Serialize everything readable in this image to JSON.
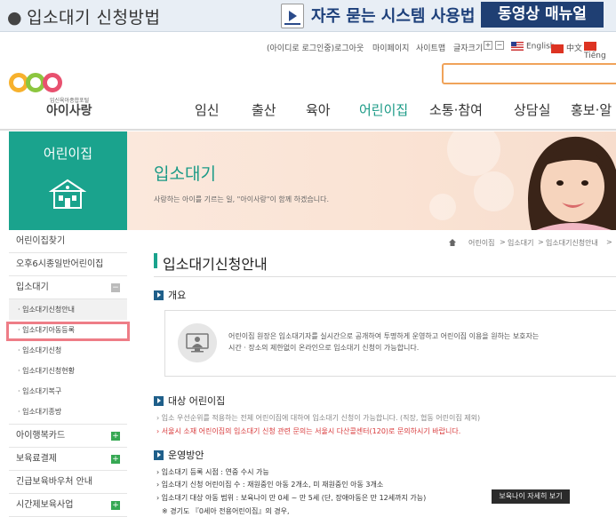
{
  "banner": {
    "title": "입소대기 신청방법",
    "faq": "자주 묻는 시스템 사용법",
    "manual": "동영상 매뉴얼"
  },
  "util": {
    "login": "(아이디로 로그인중)로그아웃",
    "mypage": "마이페이지",
    "sitemap": "사이트맵",
    "fontsize": "글자크기",
    "plus": "+",
    "minus": "−",
    "english": "English",
    "chinese": "中文",
    "vietnamese": "Tiếng"
  },
  "logo": {
    "sub": "임신육아종합포털",
    "main": "아이사랑"
  },
  "gnb": [
    "임신",
    "출산",
    "육아",
    "어린이집",
    "소통·참여",
    "상담실",
    "홍보·알"
  ],
  "sidebar": {
    "title": "어린이집",
    "items": [
      {
        "label": "어린이집찾기",
        "type": "main"
      },
      {
        "label": "오후6시종일반어린이집",
        "type": "main"
      },
      {
        "label": "입소대기",
        "type": "main",
        "toggle": "−"
      },
      {
        "label": "· 입소대기신청안내",
        "type": "sub",
        "active": true
      },
      {
        "label": "· 입소대기아동등록",
        "type": "sub"
      },
      {
        "label": "· 입소대기신청",
        "type": "sub"
      },
      {
        "label": "· 입소대기신청현황",
        "type": "sub"
      },
      {
        "label": "· 입소대기복구",
        "type": "sub"
      },
      {
        "label": "· 입소대기종방",
        "type": "sub"
      },
      {
        "label": "아이행복카드",
        "type": "main",
        "toggle": "+"
      },
      {
        "label": "보육료결제",
        "type": "main",
        "toggle": "+"
      },
      {
        "label": "긴급보육바우처 안내",
        "type": "main"
      },
      {
        "label": "시간제보육사업",
        "type": "main",
        "toggle": "+"
      }
    ]
  },
  "hero": {
    "title": "입소대기",
    "subtitle": "사랑하는 아이를 기르는 일, \"아이사랑\"이 함께 하겠습니다."
  },
  "breadcrumb": {
    "items": [
      "어린이집",
      ">",
      "입소대기",
      ">",
      "입소대기신청안내",
      ">"
    ]
  },
  "page_title": "입소대기신청안내",
  "sections": {
    "overview": {
      "title": "개요",
      "line1": "어린이집 원장은 입소대기자를 실시간으로 공개하여 투명하게 운영하고 어린이집 이용을 원하는 보호자는",
      "line2": "시간 · 장소의 제한없이 온라인으로 입소대기 신청이 가능합니다."
    },
    "target": {
      "title": "대상 어린이집",
      "line1": "› 입소 우선순위를 적용하는 전체 어린이집에 대하여 입소대기 신청이 가능합니다. (직장, 협동 어린이집 제외)",
      "line2": "› 서울시 소재 어린이집의 입소대기 신청 관련 문의는 서울시 다산콜센터(120)로 문의하시기 바랍니다."
    },
    "operation": {
      "title": "운영방안",
      "line1": "› 입소대기 등록 시점 : 연중 수시 가능",
      "line2": "› 입소대기 신청 어린이집 수 : 재원중인 아동 2개소, 미 재원중인 아동 3개소",
      "line3": "› 입소대기 대상 아동 범위 : 보육나이 만 0세 ~ 만 5세 (단, 장애아동은 만 12세까지 가능)",
      "line4": "※ 경기도 『0세아 전용어린이집』의 경우,"
    }
  },
  "tooltip": "보육나이 자세히 보기"
}
